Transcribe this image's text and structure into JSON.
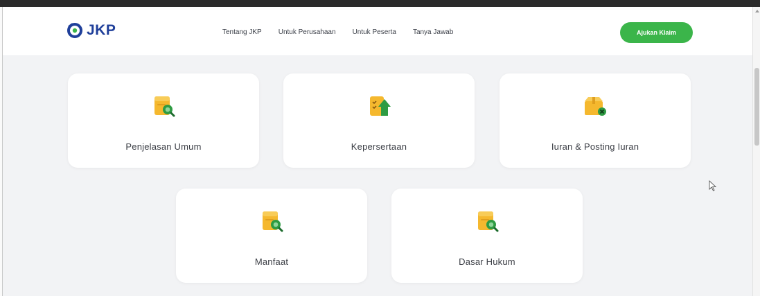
{
  "header": {
    "logo_text": "JKP",
    "nav": [
      "Tentang JKP",
      "Untuk Perusahaan",
      "Untuk Peserta",
      "Tanya Jawab"
    ],
    "cta_label": "Ajukan Klaim"
  },
  "cards": [
    {
      "label": "Penjelasan Umum",
      "icon": "folder-search-icon"
    },
    {
      "label": "Kepersertaan",
      "icon": "checklist-arrow-icon"
    },
    {
      "label": "Iuran & Posting Iuran",
      "icon": "box-check-icon"
    },
    {
      "label": "Manfaat",
      "icon": "folder-search-icon"
    },
    {
      "label": "Dasar Hukum",
      "icon": "folder-search-icon"
    }
  ],
  "colors": {
    "brand": "#1f3f9a",
    "accent": "#3bb54a",
    "icon_yellow": "#f5b82e",
    "icon_green": "#2e9b43"
  }
}
